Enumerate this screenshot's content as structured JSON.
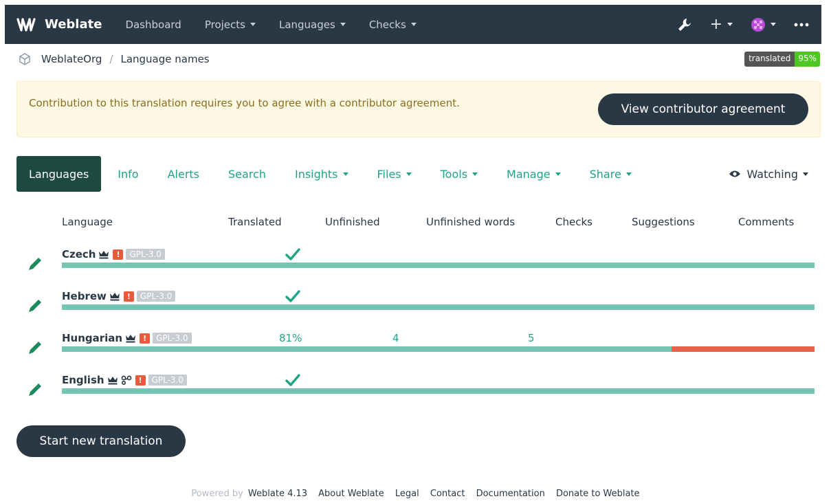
{
  "navbar": {
    "brand": "Weblate",
    "items": [
      {
        "label": "Dashboard",
        "caret": false
      },
      {
        "label": "Projects",
        "caret": true
      },
      {
        "label": "Languages",
        "caret": true
      },
      {
        "label": "Checks",
        "caret": true
      }
    ],
    "plus": "+"
  },
  "breadcrumb": {
    "project": "WeblateOrg",
    "separator": "/",
    "component": "Language names"
  },
  "badge": {
    "label": "translated",
    "value": "95%"
  },
  "alert": {
    "text": "Contribution to this translation requires you to agree with a contributor agreement.",
    "button": "View contributor agreement"
  },
  "tabs": {
    "items": [
      {
        "label": "Languages",
        "caret": false
      },
      {
        "label": "Info",
        "caret": false
      },
      {
        "label": "Alerts",
        "caret": false
      },
      {
        "label": "Search",
        "caret": false
      },
      {
        "label": "Insights",
        "caret": true
      },
      {
        "label": "Files",
        "caret": true
      },
      {
        "label": "Tools",
        "caret": true
      },
      {
        "label": "Manage",
        "caret": true
      },
      {
        "label": "Share",
        "caret": true
      }
    ],
    "watch": "Watching"
  },
  "table": {
    "headers": [
      "Language",
      "Translated",
      "Unfinished",
      "Unfinished words",
      "Checks",
      "Suggestions",
      "Comments"
    ],
    "rows": [
      {
        "language": "Czech",
        "license": "GPL-3.0",
        "translated": "",
        "complete": true,
        "unfinished": "",
        "unfinished_words": "",
        "progress": 1.0,
        "source": false
      },
      {
        "language": "Hebrew",
        "license": "GPL-3.0",
        "translated": "",
        "complete": true,
        "unfinished": "",
        "unfinished_words": "",
        "progress": 1.0,
        "source": false
      },
      {
        "language": "Hungarian",
        "license": "GPL-3.0",
        "translated": "81%",
        "complete": false,
        "unfinished": "4",
        "unfinished_words": "5",
        "progress": 0.81,
        "source": false
      },
      {
        "language": "English",
        "license": "GPL-3.0",
        "translated": "",
        "complete": true,
        "unfinished": "",
        "unfinished_words": "",
        "progress": 1.0,
        "source": true
      }
    ],
    "warning_mark": "!"
  },
  "start_button": "Start new translation",
  "footer": {
    "powered": "Powered by",
    "links": [
      "Weblate 4.13",
      "About Weblate",
      "Legal",
      "Contact",
      "Documentation",
      "Donate to Weblate"
    ]
  },
  "colors": {
    "navbar": "#2a3744",
    "accent": "#1fa385",
    "progress_ok": "#76c5b2",
    "progress_bad": "#e8624a",
    "badge_green": "#4dc820"
  }
}
